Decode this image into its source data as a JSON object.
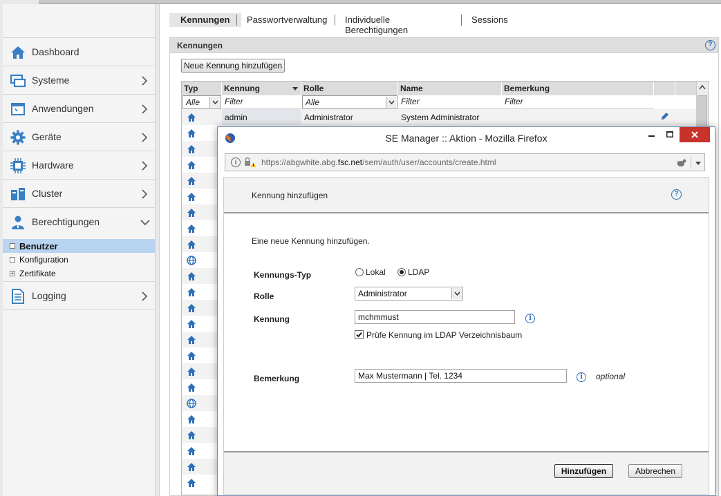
{
  "sidebar": {
    "items": [
      {
        "label": "Dashboard",
        "icon": "house-icon",
        "has_chevron": false
      },
      {
        "label": "Systeme",
        "icon": "monitor-icon",
        "has_chevron": true
      },
      {
        "label": "Anwendungen",
        "icon": "app-window-icon",
        "has_chevron": true
      },
      {
        "label": "Geräte",
        "icon": "gear-icon",
        "has_chevron": true
      },
      {
        "label": "Hardware",
        "icon": "chip-icon",
        "has_chevron": true
      },
      {
        "label": "Cluster",
        "icon": "cluster-icon",
        "has_chevron": true
      },
      {
        "label": "Berechtigungen",
        "icon": "user-icon",
        "has_chevron": true
      }
    ],
    "sub_items": [
      {
        "label": "Benutzer",
        "active": true
      },
      {
        "label": "Konfiguration",
        "active": false
      },
      {
        "label": "Zertifikate",
        "active": false,
        "expand": "+"
      }
    ],
    "logging_label": "Logging"
  },
  "tabs": [
    "Kennungen",
    "Passwortverwaltung",
    "Individuelle Berechtigungen",
    "Sessions"
  ],
  "panel": {
    "title": "Kennungen",
    "add_button": "Neue Kennung hinzufügen"
  },
  "table": {
    "headers": [
      "Typ",
      "Kennung",
      "Rolle",
      "Name",
      "Bemerkung"
    ],
    "filters": {
      "typ": "Alle",
      "kennung": "Filter",
      "rolle": "Alle",
      "name": "Filter",
      "bemerkung": "Filter"
    },
    "first_row": {
      "kennung": "admin",
      "rolle": "Administrator",
      "name": "System Administrator"
    },
    "row_icons": [
      "house",
      "house",
      "house",
      "house",
      "house",
      "house",
      "house",
      "house",
      "house",
      "globe",
      "house",
      "house",
      "house",
      "house",
      "house",
      "house",
      "house",
      "house",
      "globe",
      "house",
      "house",
      "house",
      "house",
      "house"
    ]
  },
  "dialog": {
    "window_title": "SE Manager :: Aktion - Mozilla Firefox",
    "url_prefix": "https://abgwhite.abg.",
    "url_domain": "fsc.net",
    "url_suffix": "/sem/auth/user/accounts/create.html",
    "header_title": "Kennung hinzufügen",
    "intro": "Eine neue Kennung hinzufügen.",
    "labels": {
      "typ": "Kennungs-Typ",
      "rolle": "Rolle",
      "kennung": "Kennung",
      "bemerkung": "Bemerkung"
    },
    "radio_lokal": "Lokal",
    "radio_ldap": "LDAP",
    "selected_type": "LDAP",
    "rolle_value": "Administrator",
    "kennung_value": "mchmmust",
    "checkbox_label": "Prüfe Kennung im LDAP Verzeichnisbaum",
    "checkbox_checked": true,
    "bemerkung_value": "Max Mustermann | Tel. 1234",
    "optional_label": "optional",
    "submit_label": "Hinzufügen",
    "cancel_label": "Abbrechen"
  },
  "colors": {
    "accent_blue": "#2f6fb8",
    "active_row": "#b9d4f1",
    "close_red": "#c7322b"
  }
}
